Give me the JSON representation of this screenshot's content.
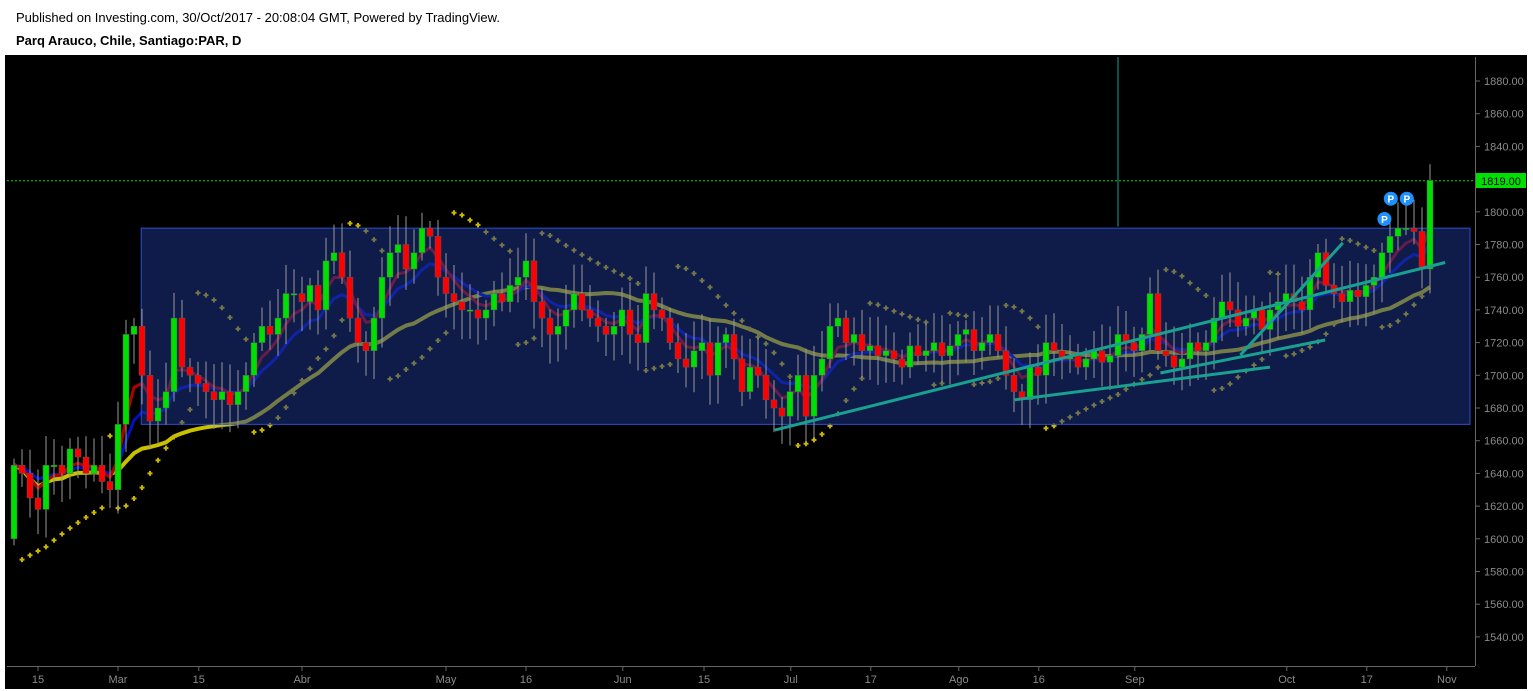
{
  "header": {
    "published": "Published on Investing.com, 30/Oct/2017 - 20:08:04 GMT, Powered by TradingView.",
    "title": "Parq Arauco, Chile, Santiago:PAR, D"
  },
  "colors": {
    "up": "#00e000",
    "down": "#ff0000",
    "ema_fast": "#b00000",
    "ema_mid": "#0010c0",
    "sma_slow": "#c8c000",
    "psar": "#c8b400",
    "trend": "#1aa090",
    "box": "#1e3690",
    "last": "#00e000",
    "marker": "#1e90ff"
  },
  "chart_data": {
    "type": "candlestick",
    "title": "Parq Arauco, Chile, Santiago:PAR, D",
    "first_open": 1600,
    "closes": [
      1645,
      1640,
      1625,
      1618,
      1645,
      1645,
      1640,
      1655,
      1650,
      1640,
      1645,
      1635,
      1630,
      1670,
      1725,
      1730,
      1700,
      1672,
      1680,
      1690,
      1735,
      1705,
      1700,
      1695,
      1690,
      1685,
      1690,
      1682,
      1690,
      1700,
      1720,
      1730,
      1725,
      1735,
      1750,
      1750,
      1745,
      1755,
      1740,
      1770,
      1775,
      1760,
      1735,
      1720,
      1715,
      1735,
      1760,
      1775,
      1780,
      1765,
      1775,
      1790,
      1785,
      1760,
      1750,
      1745,
      1740,
      1740,
      1735,
      1740,
      1750,
      1745,
      1755,
      1760,
      1770,
      1745,
      1735,
      1725,
      1730,
      1740,
      1750,
      1740,
      1735,
      1730,
      1725,
      1730,
      1740,
      1725,
      1720,
      1750,
      1740,
      1735,
      1720,
      1710,
      1705,
      1715,
      1720,
      1700,
      1720,
      1725,
      1710,
      1690,
      1705,
      1700,
      1685,
      1680,
      1675,
      1690,
      1700,
      1675,
      1700,
      1710,
      1730,
      1735,
      1720,
      1725,
      1715,
      1718,
      1712,
      1715,
      1710,
      1705,
      1718,
      1712,
      1715,
      1720,
      1712,
      1718,
      1725,
      1728,
      1715,
      1720,
      1725,
      1715,
      1700,
      1690,
      1685,
      1705,
      1700,
      1720,
      1715,
      1710,
      1712,
      1705,
      1710,
      1715,
      1708,
      1712,
      1725,
      1720,
      1715,
      1725,
      1750,
      1715,
      1712,
      1705,
      1710,
      1720,
      1715,
      1720,
      1735,
      1745,
      1740,
      1730,
      1735,
      1740,
      1728,
      1740,
      1745,
      1750,
      1745,
      1740,
      1760,
      1775,
      1755,
      1750,
      1745,
      1752,
      1748,
      1755,
      1760,
      1775,
      1785,
      1790,
      1790,
      1788,
      1765,
      1819
    ],
    "ylim": [
      1530,
      1890
    ],
    "yticks": [
      1540,
      1560,
      1580,
      1600,
      1620,
      1640,
      1660,
      1680,
      1700,
      1720,
      1740,
      1760,
      1780,
      1800,
      1820,
      1840,
      1860,
      1880
    ],
    "xticks": [
      {
        "label": "15",
        "index": 3
      },
      {
        "label": "Mar",
        "index": 13
      },
      {
        "label": "15",
        "index": 23.1
      },
      {
        "label": "Abr",
        "index": 36
      },
      {
        "label": "May",
        "index": 54
      },
      {
        "label": "16",
        "index": 64
      },
      {
        "label": "Jun",
        "index": 76.1
      },
      {
        "label": "15",
        "index": 86.25
      },
      {
        "label": "Jul",
        "index": 97.1
      },
      {
        "label": "17",
        "index": 107.1
      },
      {
        "label": "Ago",
        "index": 118.1
      },
      {
        "label": "16",
        "index": 128.1
      },
      {
        "label": "Sep",
        "index": 140.1
      },
      {
        "label": "Oct",
        "index": 159.1
      },
      {
        "label": "17",
        "index": 169.1
      },
      {
        "label": "Nov",
        "index": 179.1
      }
    ],
    "last_price_label": "1819.00",
    "last_price": 1819,
    "indicators": {
      "ema_fast": 5,
      "ema_mid": 10,
      "sma_slow": 30,
      "psar": {
        "step": 0.02,
        "max": 0.2
      }
    },
    "range_box": {
      "from_index": 15.9,
      "to_index": 182,
      "top": 1790,
      "bottom": 1670
    },
    "trendlines": [
      {
        "from": [
          95.1,
          1666.5
        ],
        "to": [
          178.9,
          1769
        ]
      },
      {
        "from": [
          125.1,
          1685
        ],
        "to": [
          157,
          1705
        ]
      },
      {
        "from": [
          143.3,
          1701.4
        ],
        "to": [
          163.9,
          1721.6
        ]
      },
      {
        "from": [
          153.3,
          1712.4
        ],
        "to": [
          166.1,
          1781
        ]
      }
    ],
    "vertical_marker": {
      "index": 138,
      "price": 1791
    },
    "markers": [
      {
        "label": "P",
        "index": 171.3,
        "price": 1795.6
      },
      {
        "label": "P",
        "index": 172.1,
        "price": 1808
      },
      {
        "label": "P",
        "index": 174.1,
        "price": 1808
      }
    ]
  }
}
